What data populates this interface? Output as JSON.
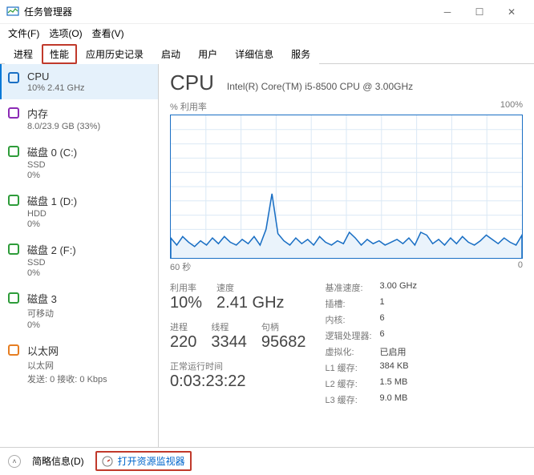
{
  "window": {
    "title": "任务管理器"
  },
  "menu": {
    "file": "文件(F)",
    "options": "选项(O)",
    "view": "查看(V)"
  },
  "tabs": {
    "processes": "进程",
    "performance": "性能",
    "apphistory": "应用历史记录",
    "startup": "启动",
    "users": "用户",
    "details": "详细信息",
    "services": "服务"
  },
  "sidebar": {
    "cpu": {
      "name": "CPU",
      "sub": "10% 2.41 GHz"
    },
    "mem": {
      "name": "内存",
      "sub": "8.0/23.9 GB (33%)"
    },
    "disk0": {
      "name": "磁盘 0 (C:)",
      "sub1": "SSD",
      "sub2": "0%"
    },
    "disk1": {
      "name": "磁盘 1 (D:)",
      "sub1": "HDD",
      "sub2": "0%"
    },
    "disk2": {
      "name": "磁盘 2 (F:)",
      "sub1": "SSD",
      "sub2": "0%"
    },
    "disk3": {
      "name": "磁盘 3",
      "sub1": "可移动",
      "sub2": "0%"
    },
    "eth": {
      "name": "以太网",
      "sub1": "以太网",
      "sub2": "发送: 0 接收: 0 Kbps"
    }
  },
  "main": {
    "title": "CPU",
    "desc": "Intel(R) Core(TM) i5-8500 CPU @ 3.00GHz",
    "chart_top_left": "% 利用率",
    "chart_top_right": "100%",
    "chart_bot_left": "60 秒",
    "chart_bot_right": "0",
    "util_lbl": "利用率",
    "util_val": "10%",
    "speed_lbl": "速度",
    "speed_val": "2.41 GHz",
    "proc_lbl": "进程",
    "proc_val": "220",
    "thread_lbl": "线程",
    "thread_val": "3344",
    "handle_lbl": "句柄",
    "handle_val": "95682",
    "uptime_lbl": "正常运行时间",
    "uptime_val": "0:03:23:22",
    "info": {
      "base_k": "基准速度:",
      "base_v": "3.00 GHz",
      "sockets_k": "插槽:",
      "sockets_v": "1",
      "cores_k": "内核:",
      "cores_v": "6",
      "lproc_k": "逻辑处理器:",
      "lproc_v": "6",
      "virt_k": "虚拟化:",
      "virt_v": "已启用",
      "l1_k": "L1 缓存:",
      "l1_v": "384 KB",
      "l2_k": "L2 缓存:",
      "l2_v": "1.5 MB",
      "l3_k": "L3 缓存:",
      "l3_v": "9.0 MB"
    }
  },
  "status": {
    "fewer": "简略信息(D)",
    "resmon": "打开资源监视器"
  },
  "chart_data": {
    "type": "line",
    "title": "% 利用率",
    "xlabel": "60 秒",
    "ylabel": "",
    "ylim": [
      0,
      100
    ],
    "x": [
      0,
      1,
      2,
      3,
      4,
      5,
      6,
      7,
      8,
      9,
      10,
      11,
      12,
      13,
      14,
      15,
      16,
      17,
      18,
      19,
      20,
      21,
      22,
      23,
      24,
      25,
      26,
      27,
      28,
      29,
      30,
      31,
      32,
      33,
      34,
      35,
      36,
      37,
      38,
      39,
      40,
      41,
      42,
      43,
      44,
      45,
      46,
      47,
      48,
      49,
      50,
      51,
      52,
      53,
      54,
      55,
      56,
      57,
      58,
      59
    ],
    "values": [
      14,
      9,
      15,
      11,
      8,
      12,
      9,
      14,
      10,
      15,
      11,
      9,
      13,
      10,
      15,
      9,
      20,
      45,
      17,
      12,
      9,
      14,
      10,
      13,
      9,
      15,
      11,
      9,
      12,
      10,
      18,
      14,
      9,
      13,
      10,
      12,
      9,
      11,
      13,
      10,
      14,
      9,
      18,
      16,
      10,
      13,
      9,
      14,
      10,
      15,
      11,
      9,
      12,
      16,
      13,
      10,
      14,
      11,
      9,
      16
    ]
  }
}
